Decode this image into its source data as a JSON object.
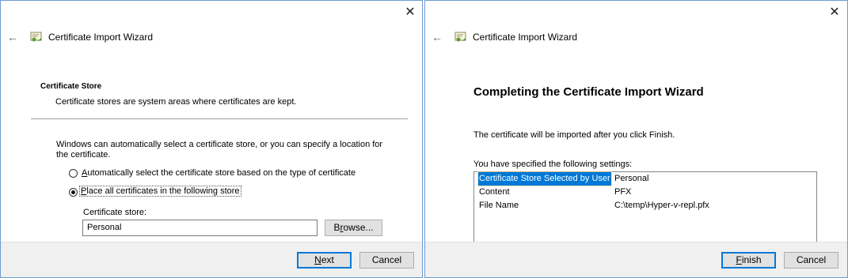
{
  "wizard1": {
    "title": "Certificate Import Wizard",
    "section_title": "Certificate Store",
    "section_desc": "Certificate stores are system areas where certificates are kept.",
    "intro_line1": "Windows can automatically select a certificate store, or you can specify a location for",
    "intro_line2": "the certificate.",
    "radio_auto": {
      "mnemonic": "A",
      "rest": "utomatically select the certificate store based on the type of certificate",
      "checked": false
    },
    "radio_place": {
      "mnemonic": "P",
      "rest": "lace all certificates in the following store",
      "checked": true
    },
    "store_label": "Certificate store:",
    "store_value": "Personal",
    "browse": {
      "pre": "B",
      "mnemonic": "r",
      "rest": "owse..."
    },
    "next": {
      "mnemonic": "N",
      "rest": "ext"
    },
    "cancel": "Cancel"
  },
  "wizard2": {
    "title": "Certificate Import Wizard",
    "heading": "Completing the Certificate Import Wizard",
    "info": "The certificate will be imported after you click Finish.",
    "settings_label": "You have specified the following settings:",
    "settings": [
      {
        "name": "Certificate Store Selected by User",
        "value": "Personal",
        "selected": true
      },
      {
        "name": "Content",
        "value": "PFX",
        "selected": false
      },
      {
        "name": "File Name",
        "value": "C:\\temp\\Hyper-v-repl.pfx",
        "selected": false
      }
    ],
    "finish": {
      "mnemonic": "F",
      "rest": "inish"
    },
    "cancel": "Cancel"
  },
  "icons": {
    "close": "close-icon",
    "back": "back-arrow-icon",
    "cert": "certificate-icon"
  },
  "colors": {
    "selection": "#0078d7",
    "footer": "#f0f0f0",
    "border": "#6f9bd1"
  }
}
